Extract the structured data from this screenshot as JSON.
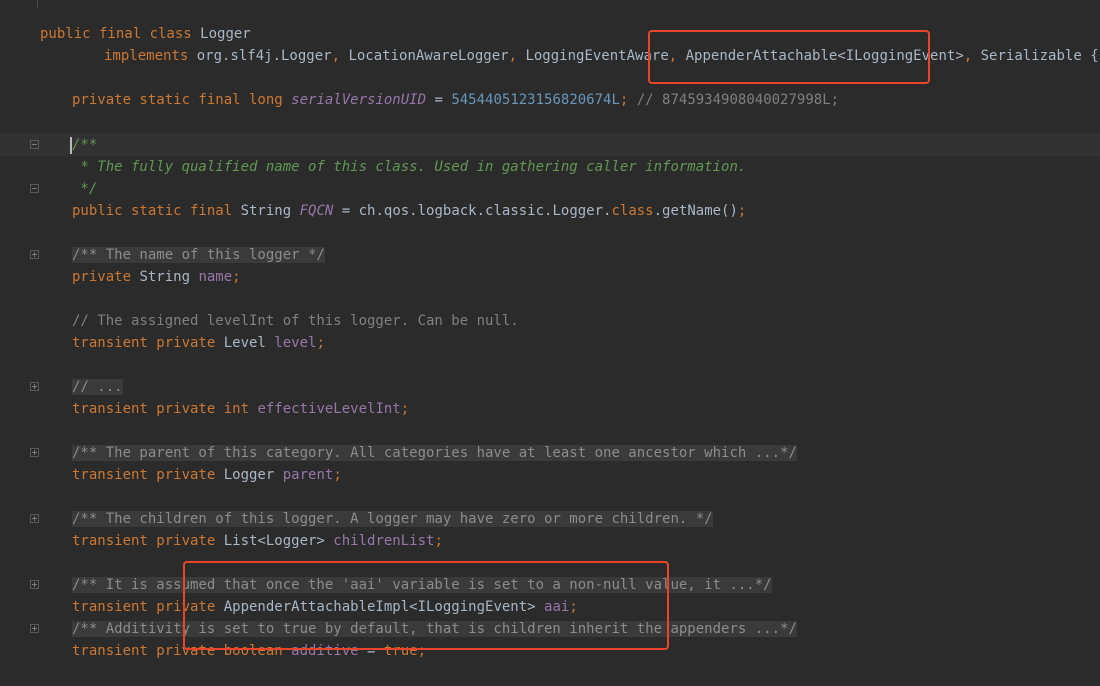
{
  "code": {
    "line1": {
      "kw": "public final class ",
      "name": "Logger"
    },
    "line2": {
      "kw_implements": "implements ",
      "t1": "org.slf4j.Logger",
      "c1": ", ",
      "t2": "LocationAwareLogger",
      "c2": ", ",
      "t3": "LoggingEventAware",
      "c3": ", ",
      "t4": "AppenderAttachable<ILoggingEvent>",
      "c4": ", ",
      "t5": "Serializable {"
    },
    "line3": {
      "kw": "private static final long ",
      "field": "serialVersionUID",
      "eq": " = ",
      "num": "5454405123156820674L",
      "semi": ";",
      "comment": " // 8745934908040027998L;"
    },
    "line4": {
      "doc": "/**"
    },
    "line5": {
      "doc": " * The fully qualified name of this class. Used in gathering caller information."
    },
    "line6": {
      "doc": " */"
    },
    "line7": {
      "kw": "public static final ",
      "type": "String ",
      "field": "FQCN",
      "rest1": " = ch.qos.logback.classic.Logger.",
      "kw_class": "class",
      "rest2": ".getName()",
      "semi": ";"
    },
    "line8": {
      "folded": "/** The name of this logger */"
    },
    "line9": {
      "kw": "private ",
      "type": "String ",
      "field": "name",
      "semi": ";"
    },
    "line10": {
      "comment": "// The assigned levelInt of this logger. Can be null."
    },
    "line11": {
      "kw": "transient private ",
      "type": "Level ",
      "field": "level",
      "semi": ";"
    },
    "line12": {
      "folded": "// ..."
    },
    "line13": {
      "kw": "transient private int ",
      "field": "effectiveLevelInt",
      "semi": ";"
    },
    "line14": {
      "folded": "/** The parent of this category. All categories have at least one ancestor which ...*/"
    },
    "line15": {
      "kw": "transient private ",
      "type": "Logger ",
      "field": "parent",
      "semi": ";"
    },
    "line16": {
      "folded": "/** The children of this logger. A logger may have zero or more children. */"
    },
    "line17": {
      "kw": "transient private ",
      "type": "List<Logger> ",
      "field": "childrenList",
      "semi": ";"
    },
    "line18": {
      "folded": "/** It is assumed that once the 'aai' variable is set to a non-null value, it ...*/"
    },
    "line19": {
      "kw": "transient private ",
      "type": "AppenderAttachableImpl<ILoggingEvent> ",
      "field": "aai",
      "semi": ";"
    },
    "line20": {
      "folded": "/** Additivity is set to true by default, that is children inherit the appenders ...*/"
    },
    "line21": {
      "kw": "transient private boolean ",
      "field": "additive",
      "eq": " = ",
      "kw_true": "true",
      "semi": ";"
    }
  },
  "colors": {
    "background": "#2b2b2b",
    "keyword": "#cc7832",
    "number": "#6897bb",
    "field": "#9876aa",
    "doc_comment": "#629755",
    "line_comment": "#808080",
    "highlight_box": "#e8452a"
  }
}
